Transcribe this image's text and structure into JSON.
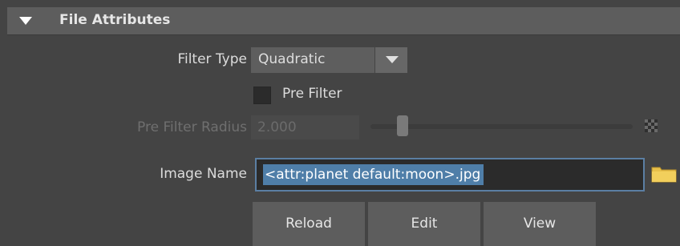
{
  "section": {
    "title": "File Attributes",
    "collapse_icon": "triangle-down-icon"
  },
  "filter_type": {
    "label": "Filter Type",
    "value": "Quadratic",
    "arrow_icon": "chevron-down-icon"
  },
  "pre_filter": {
    "label": "Pre Filter",
    "checked": false
  },
  "pre_filter_radius": {
    "label": "Pre Filter Radius",
    "value": "2.000",
    "slider_fraction": 0.12,
    "enabled": false,
    "map_icon": "checker-map-icon"
  },
  "image_name": {
    "label": "Image Name",
    "value": "<attr:planet default:moon>.jpg",
    "browse_icon": "folder-icon"
  },
  "buttons": {
    "reload": "Reload",
    "edit": "Edit",
    "view": "View"
  },
  "colors": {
    "panel_bg": "#444444",
    "header_bg": "#5d5d5d",
    "selection": "#4f7ea8",
    "field_border": "#5b7fa3",
    "folder": "#e8c04a"
  }
}
